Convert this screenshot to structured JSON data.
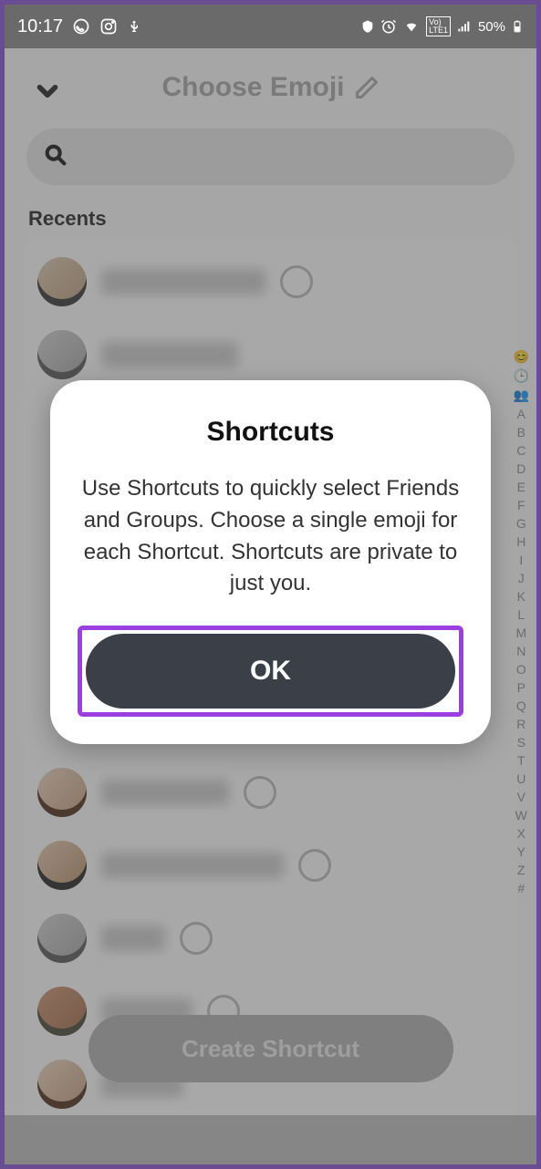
{
  "status": {
    "time": "10:17",
    "battery_pct": "50%"
  },
  "header": {
    "title": "Choose Emoji"
  },
  "section": {
    "recents_label": "Recents"
  },
  "alpha_index": [
    "😊",
    "🕒",
    "👥",
    "A",
    "B",
    "C",
    "D",
    "E",
    "F",
    "G",
    "H",
    "I",
    "J",
    "K",
    "L",
    "M",
    "N",
    "O",
    "P",
    "Q",
    "R",
    "S",
    "T",
    "U",
    "V",
    "W",
    "X",
    "Y",
    "Z",
    "#"
  ],
  "create_button": {
    "label": "Create Shortcut"
  },
  "modal": {
    "title": "Shortcuts",
    "body": "Use Shortcuts to quickly select Friends and Groups. Choose a single emoji for each Shortcut. Shortcuts are private to just you.",
    "ok_label": "OK"
  }
}
